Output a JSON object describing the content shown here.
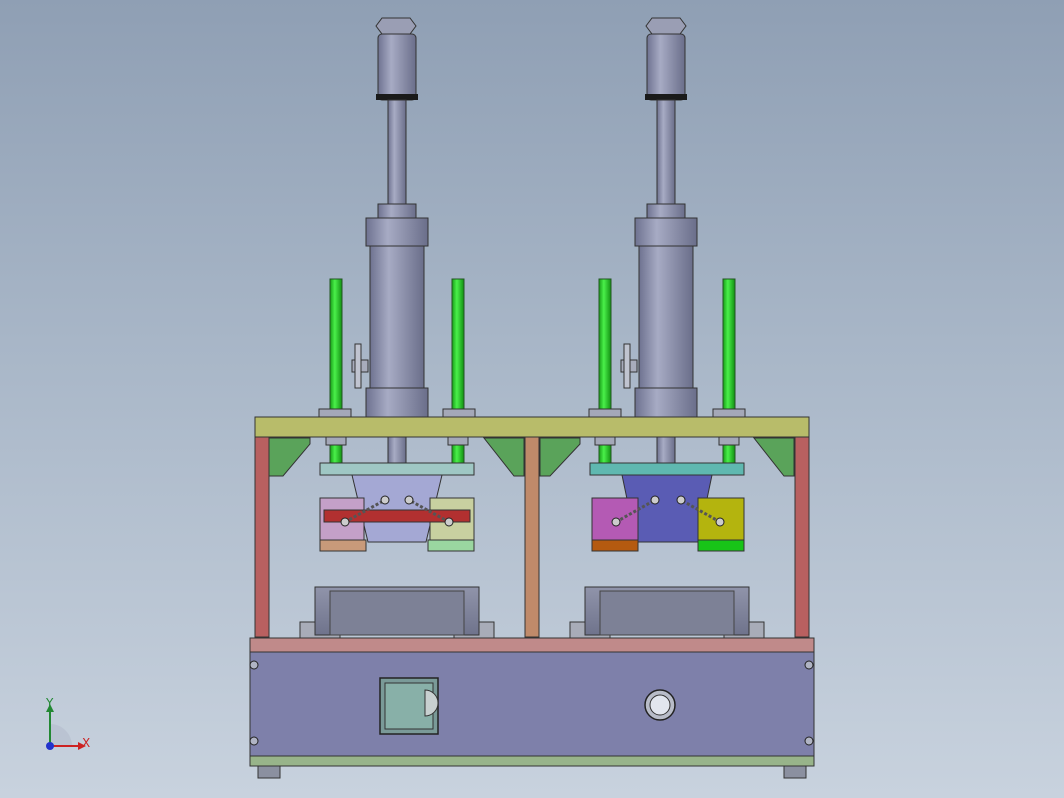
{
  "viewport": {
    "description_hidden": "",
    "colors": {
      "background_top": "#8f9fb4",
      "background_bottom": "#c8d2de",
      "cylinder": "#8a8ea8",
      "guide_rod": "#22cc22",
      "top_plate": "#b8bc6a",
      "side_post": "#b86060",
      "center_post": "#c08a6a",
      "base_box": "#7e80aa",
      "base_top_strip": "#c08a8a",
      "base_bottom_strip": "#98b48a",
      "gusset": "#5aa35a"
    }
  },
  "triad": {
    "x_label": "X",
    "y_label": "Y"
  }
}
